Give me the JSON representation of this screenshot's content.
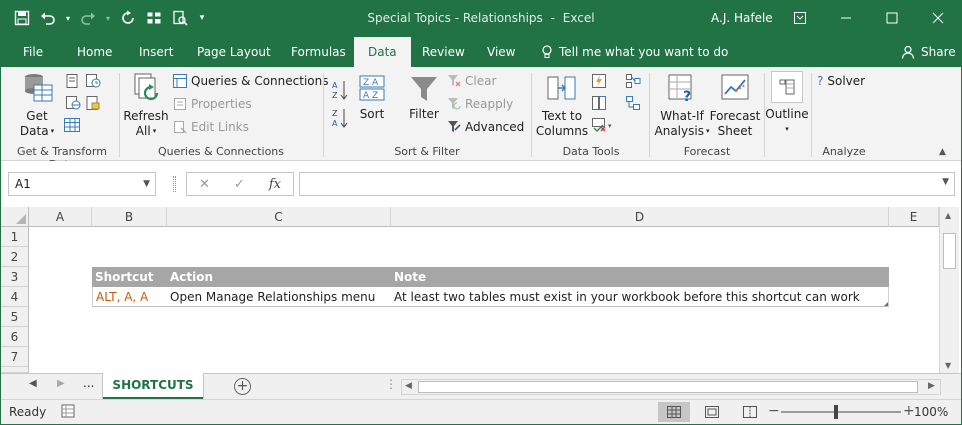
{
  "window": {
    "title": "Special Topics - Relationships",
    "app": "Excel",
    "user": "A.J. Hafele"
  },
  "tabs": [
    {
      "label": "File"
    },
    {
      "label": "Home"
    },
    {
      "label": "Insert"
    },
    {
      "label": "Page Layout"
    },
    {
      "label": "Formulas"
    },
    {
      "label": "Data"
    },
    {
      "label": "Review"
    },
    {
      "label": "View"
    }
  ],
  "active_tab": "Data",
  "tell_me": "Tell me what you want to do",
  "share": "Share",
  "ribbon": {
    "get_transform": {
      "get_data_line1": "Get",
      "get_data_line2": "Data",
      "label": "Get & Transform Data"
    },
    "queries": {
      "refresh_line1": "Refresh",
      "refresh_line2": "All",
      "queries_connections": "Queries & Connections",
      "properties": "Properties",
      "edit_links": "Edit Links",
      "label": "Queries & Connections"
    },
    "sort_filter": {
      "sort": "Sort",
      "filter": "Filter",
      "clear": "Clear",
      "reapply": "Reapply",
      "advanced": "Advanced",
      "label": "Sort & Filter"
    },
    "data_tools": {
      "text_to_line1": "Text to",
      "text_to_line2": "Columns",
      "label": "Data Tools"
    },
    "forecast": {
      "whatif_line1": "What-If",
      "whatif_line2": "Analysis",
      "forecast_line1": "Forecast",
      "forecast_line2": "Sheet",
      "label": "Forecast"
    },
    "outline": {
      "outline": "Outline"
    },
    "analyze": {
      "solver": "Solver",
      "label": "Analyze"
    }
  },
  "formula_bar": {
    "name_box": "A1",
    "fx": "fx",
    "formula": ""
  },
  "columns": [
    "A",
    "B",
    "C",
    "D",
    "E"
  ],
  "rows": [
    "1",
    "2",
    "3",
    "4",
    "5",
    "6",
    "7"
  ],
  "table": {
    "headers": [
      "Shortcut",
      "Action",
      "Note"
    ],
    "row": {
      "shortcut": "ALT, A, A",
      "action": "Open Manage Relationships menu",
      "note": "At least two tables must exist in your workbook before this shortcut can work"
    }
  },
  "sheets": {
    "ellipsis": "...",
    "active": "SHORTCUTS"
  },
  "status": {
    "ready": "Ready",
    "zoom": "100%"
  },
  "colors": {
    "brand": "#217346",
    "header_fill": "#a6a6a6",
    "shortcut_text": "#c55a11"
  }
}
